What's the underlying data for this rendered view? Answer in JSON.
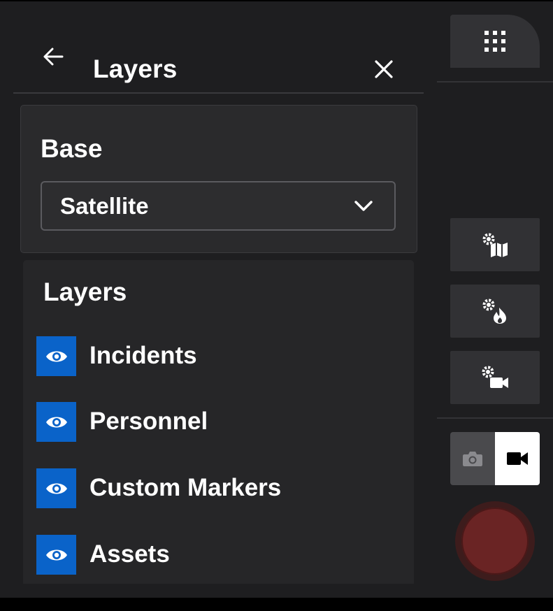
{
  "panel": {
    "title": "Layers",
    "back_icon": "arrow-left-icon",
    "close_icon": "close-icon"
  },
  "base": {
    "heading": "Base",
    "selected": "Satellite"
  },
  "layers": {
    "heading": "Layers",
    "items": [
      {
        "label": "Incidents",
        "visible": true
      },
      {
        "label": "Personnel",
        "visible": true
      },
      {
        "label": "Custom Markers",
        "visible": true
      },
      {
        "label": "Assets",
        "visible": true
      }
    ]
  },
  "toolbar": {
    "tools": [
      {
        "icon": "map-settings-icon"
      },
      {
        "icon": "fire-settings-icon"
      },
      {
        "icon": "camera-settings-icon"
      }
    ],
    "capture_mode": "video"
  },
  "colors": {
    "accent": "#0a63c9",
    "panel_bg": "#262628",
    "record": "#6a2424"
  }
}
